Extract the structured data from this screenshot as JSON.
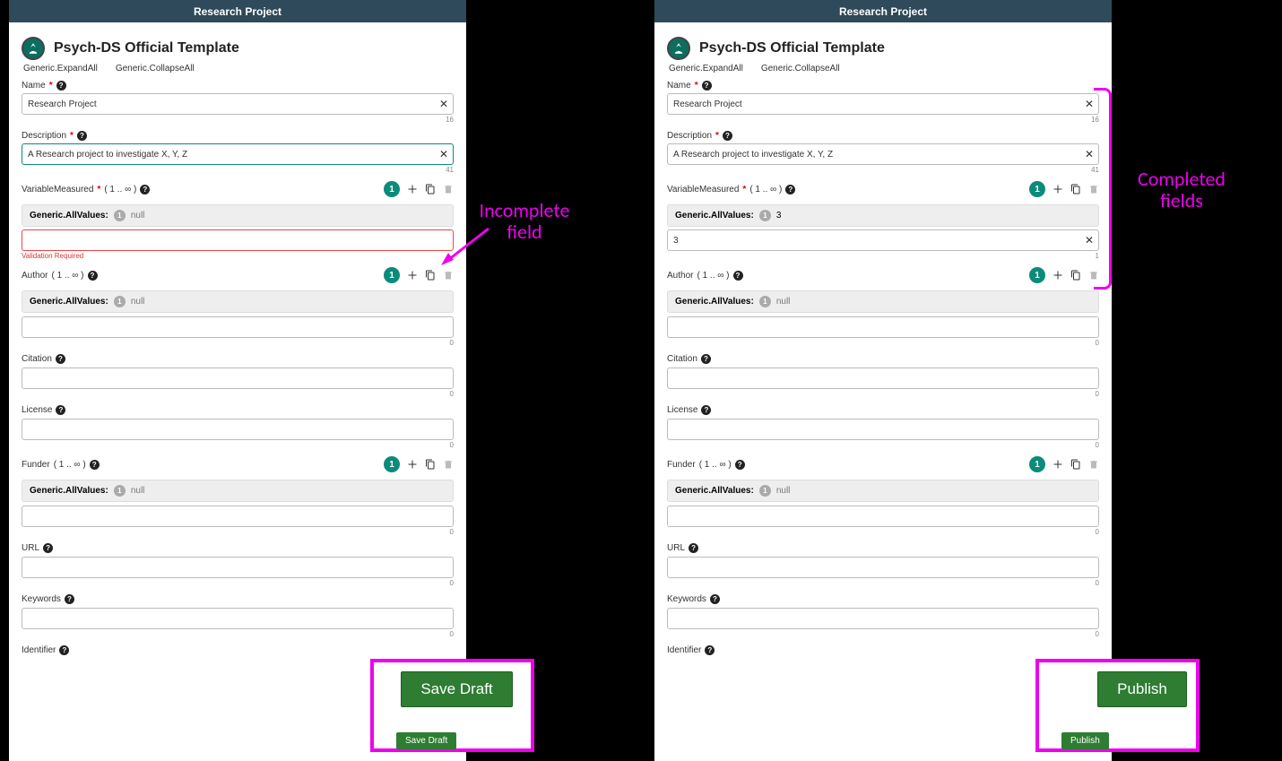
{
  "header_title": "Research Project",
  "page_title": "Psych-DS Official Template",
  "expand": "Generic.ExpandAll",
  "collapse": "Generic.CollapseAll",
  "name_label": "Name",
  "name_value": "Research Project",
  "name_count": "16",
  "desc_label": "Description",
  "desc_value": "A Research project to investigate X, Y, Z",
  "desc_count": "41",
  "var_label": "VariableMeasured",
  "cardinality": "( 1 .. ∞ )",
  "badge1": "1",
  "allvalues_label": "Generic.AllValues:",
  "mini1": "1",
  "null_text": "null",
  "var_right_val": "3",
  "var_right_input": "3",
  "var_right_count": "1",
  "validation_err": "Validation Required",
  "author_label": "Author",
  "citation_label": "Citation",
  "license_label": "License",
  "funder_label": "Funder",
  "url_label": "URL",
  "keywords_label": "Keywords",
  "identifier_label": "Identifier",
  "count0": "0",
  "anno_incomplete": "Incomplete field",
  "anno_complete": "Completed fields",
  "btn_save": "Save Draft",
  "btn_publish": "Publish"
}
